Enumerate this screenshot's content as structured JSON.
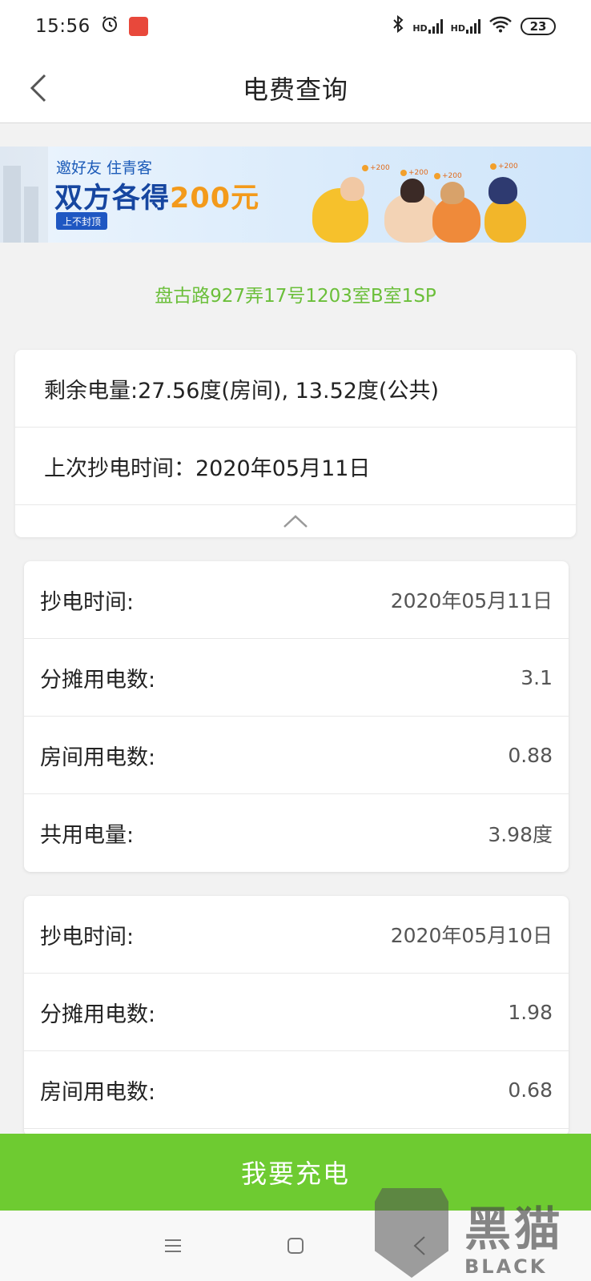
{
  "status_bar": {
    "time": "15:56",
    "battery": "23",
    "network_label": "HD"
  },
  "header": {
    "title": "电费查询"
  },
  "banner": {
    "line1": "邀好友 住青客",
    "line2_prefix": "双方各得",
    "line2_amount": "200元",
    "tag": "上不封顶",
    "coin_label": "+200"
  },
  "address": "盘古路927弄17号1203室B室1SP",
  "summary": {
    "remaining": "剩余电量:27.56度(房间), 13.52度(公共)",
    "last_read": "上次抄电时间：2020年05月11日"
  },
  "records": [
    {
      "rows": [
        {
          "label": "抄电时间:",
          "value": "2020年05月11日"
        },
        {
          "label": "分摊用电数:",
          "value": "3.1"
        },
        {
          "label": "房间用电数:",
          "value": "0.88"
        },
        {
          "label": "共用电量:",
          "value": "3.98度"
        }
      ]
    },
    {
      "rows": [
        {
          "label": "抄电时间:",
          "value": "2020年05月10日"
        },
        {
          "label": "分摊用电数:",
          "value": "1.98"
        },
        {
          "label": "房间用电数:",
          "value": "0.68"
        }
      ]
    }
  ],
  "charge_button": "我要充电",
  "watermark": {
    "cn": "黑猫",
    "en": "BLACK CAT"
  },
  "colors": {
    "accent_green": "#6ecb31",
    "address_green": "#6bbf3a"
  },
  "icons": [
    "back-chevron-icon",
    "alarm-icon",
    "bluetooth-icon",
    "signal-icon",
    "wifi-icon",
    "chevron-up-icon",
    "menu-icon",
    "home-square-icon",
    "back-triangle-icon"
  ]
}
